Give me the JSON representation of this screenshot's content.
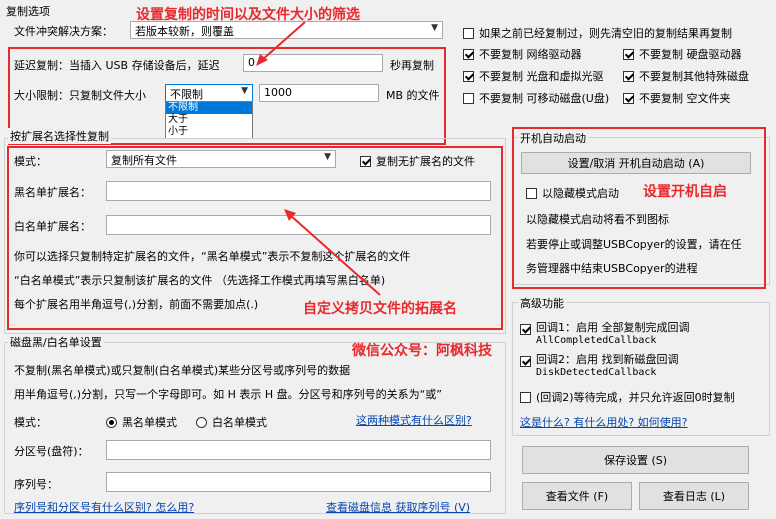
{
  "copy_options": {
    "title": "复制选项",
    "conflict_label": "文件冲突解决方案：",
    "conflict_value": "若版本较新，则覆盖",
    "delay_label": "延迟复制：当插入 USB 存储设备后，延迟",
    "delay_value": "0",
    "delay_unit": "秒再复制",
    "size_label": "大小限制：只复制文件大小",
    "size_value": "不限制",
    "size_options": [
      "不限制",
      "大于",
      "小于"
    ],
    "size_number": "1000",
    "size_unit": "MB 的文件"
  },
  "right_checks": {
    "skip_copied": "如果之前已经复制过，则先清空旧的复制结果再复制",
    "no_network": "不要复制 网络驱动器",
    "no_hdd": "不要复制 硬盘驱动器",
    "no_optical": "不要复制 光盘和虚拟光驱",
    "no_special": "不要复制其他特殊磁盘",
    "no_removable": "不要复制 可移动磁盘(U盘)",
    "no_empty_folder": "不要复制 空文件夹"
  },
  "ext": {
    "title": "按扩展名选择性复制",
    "mode_label": "模式：",
    "mode_value": "复制所有文件",
    "copy_no_ext": "复制无扩展名的文件",
    "black_label": "黑名单扩展名：",
    "white_label": "白名单扩展名：",
    "help1": "你可以选择只复制特定扩展名的文件，“黑名单模式”表示不复制这个扩展名的文件",
    "help2": "“白名单模式”表示只复制该扩展名的文件  （先选择工作模式再填写黑白名单)",
    "help3": "每个扩展名用半角逗号(,)分割，前面不需要加点(.)"
  },
  "disk": {
    "title": "磁盘黑/白名单设置",
    "help1": "不复制(黑名单模式)或只复制(白名单模式)某些分区号或序列号的数据",
    "help2": "用半角逗号(,)分割，只写一个字母即可。如 H 表示 H 盘。分区号和序列号的关系为“或”",
    "mode_label": "模式：",
    "black_mode": "黑名单模式",
    "white_mode": "白名单模式",
    "mode_link": "这两种模式有什么区别?",
    "part_label": "分区号(盘符)：",
    "serial_label": "序列号：",
    "link_diff": "序列号和分区号有什么区别? 怎么用?",
    "link_info": "查看磁盘信息  获取序列号 (V)"
  },
  "autostart": {
    "title": "开机自动启动",
    "button": "设置/取消 开机自动启动 (A)",
    "hidden": "以隐藏模式启动",
    "info1": "以隐藏模式启动将看不到图标",
    "info2": "若要停止或调整USBCopyer的设置，请在任",
    "info3": "务管理器中结束USBCopyer的进程"
  },
  "advanced": {
    "title": "高级功能",
    "cb1_label": "回调1：启用 全部复制完成回调",
    "cb1_name": "AllCompletedCallback",
    "cb2_label": "回调2：启用 找到新磁盘回调",
    "cb2_name": "DiskDetectedCallback",
    "cb_wait": "(回调2)等待完成，并只允许返回0时复制",
    "link": "这是什么? 有什么用处? 如何使用?"
  },
  "buttons": {
    "save": "保存设置 (S)",
    "view_file": "查看文件 (F)",
    "view_log": "查看日志 (L)"
  },
  "annotations": {
    "top": "设置复制的时间以及文件大小的筛选",
    "autostart": "设置开机自启",
    "ext": "自定义拷贝文件的拓展名",
    "wechat": "微信公众号：阿枫科技"
  },
  "colors": {
    "annotation": "#e8292d",
    "link": "#0645ad",
    "selected": "#0078d7"
  }
}
